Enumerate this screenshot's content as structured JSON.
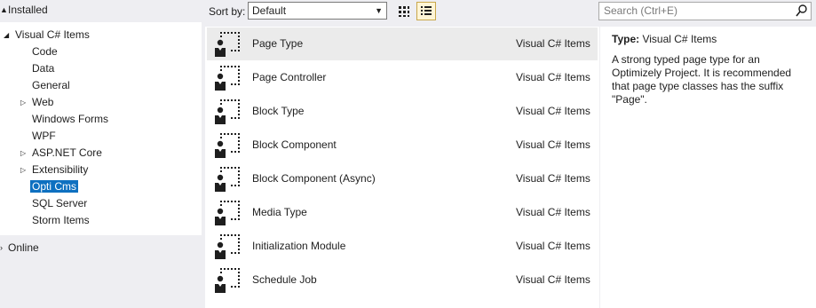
{
  "left": {
    "installed": {
      "label": "Installed"
    },
    "tree": {
      "root": "Visual C# Items",
      "items": [
        {
          "label": "Code",
          "expandable": false
        },
        {
          "label": "Data",
          "expandable": false
        },
        {
          "label": "General",
          "expandable": false
        },
        {
          "label": "Web",
          "expandable": true
        },
        {
          "label": "Windows Forms",
          "expandable": false
        },
        {
          "label": "WPF",
          "expandable": false
        },
        {
          "label": "ASP.NET Core",
          "expandable": true
        },
        {
          "label": "Extensibility",
          "expandable": true
        },
        {
          "label": "Opti Cms",
          "expandable": false,
          "selected": true
        },
        {
          "label": "SQL Server",
          "expandable": false
        },
        {
          "label": "Storm Items",
          "expandable": false
        }
      ]
    },
    "online": {
      "label": "Online"
    }
  },
  "toolbar": {
    "sort_label": "Sort by:",
    "sort_value": "Default",
    "search_placeholder": "Search (Ctrl+E)"
  },
  "templates": [
    {
      "name": "Page Type",
      "lang": "Visual C# Items",
      "hovered": true
    },
    {
      "name": "Page Controller",
      "lang": "Visual C# Items"
    },
    {
      "name": "Block Type",
      "lang": "Visual C# Items"
    },
    {
      "name": "Block Component",
      "lang": "Visual C# Items"
    },
    {
      "name": "Block Component (Async)",
      "lang": "Visual C# Items"
    },
    {
      "name": "Media Type",
      "lang": "Visual C# Items"
    },
    {
      "name": "Initialization Module",
      "lang": "Visual C# Items"
    },
    {
      "name": "Schedule Job",
      "lang": "Visual C# Items"
    }
  ],
  "details": {
    "type_label": "Type:",
    "type_value": "Visual C# Items",
    "description": "A strong typed page type for an Optimizely Project. It is recommended that page type classes has the suffix \"Page\"."
  },
  "colors": {
    "selection": "#0e70c0",
    "panel_bg": "#eeeef2",
    "hover_row": "#ebebeb",
    "active_view_border": "#c9a74a"
  },
  "icons": {
    "template": "template-item-icon",
    "expand": "expand-triangle-icon",
    "collapse": "collapse-triangle-icon",
    "search": "search-icon",
    "grid_view": "grid-view-icon",
    "list_view": "list-view-icon"
  }
}
